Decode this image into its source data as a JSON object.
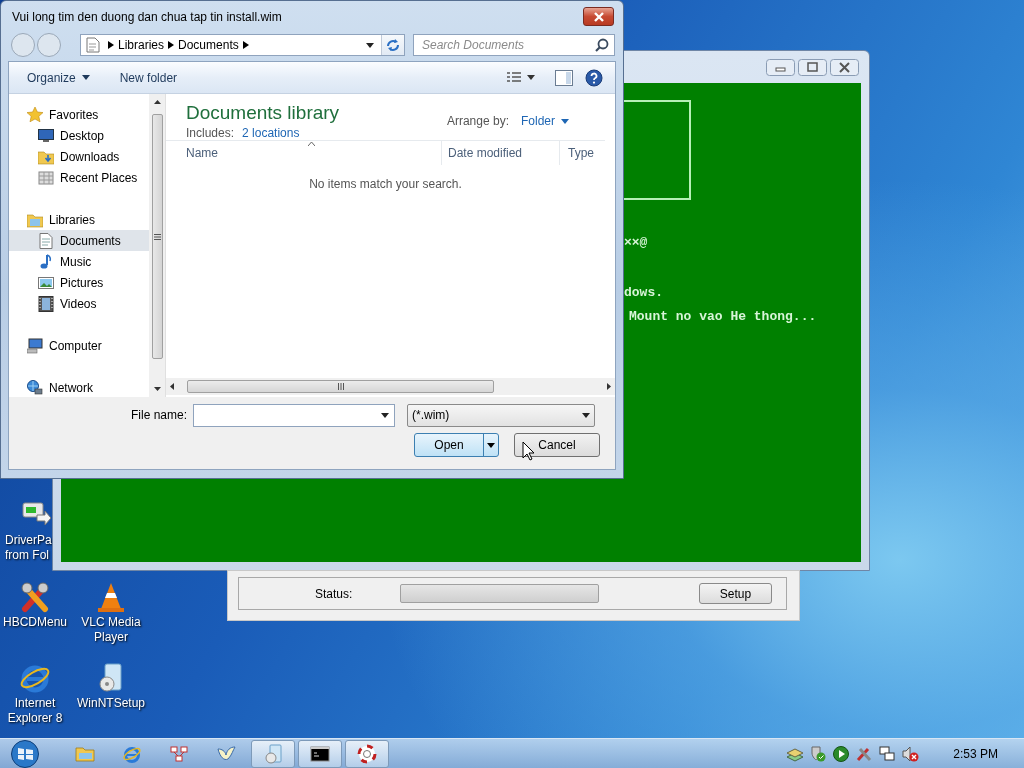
{
  "desktop_icons": [
    {
      "lines": [
        "DriverPa",
        "from Fol"
      ]
    },
    {
      "lines": [
        "HBCDMenu"
      ]
    },
    {
      "lines": [
        "VLC Media",
        "Player"
      ]
    },
    {
      "lines": [
        "Internet",
        "Explorer 8"
      ]
    },
    {
      "lines": [
        "WinNTSetup"
      ]
    }
  ],
  "console_window": {
    "lines": [
      "××@",
      "dows.",
      "Mount no vao He thong..."
    ]
  },
  "setup_window": {
    "status_label": "Status:",
    "progress": {
      "level": 0
    },
    "setup_button": "Setup"
  },
  "dialog": {
    "title": "Vui long tim den duong dan chua tap tin install.wim",
    "breadcrumb": [
      "Libraries",
      "Documents"
    ],
    "search": {
      "placeholder": "Search Documents"
    },
    "toolbar": {
      "organize": "Organize",
      "new_folder": "New folder"
    },
    "navigation": [
      {
        "label": "Favorites",
        "selected": false,
        "children": [
          {
            "label": "Desktop",
            "selected": false
          },
          {
            "label": "Downloads",
            "selected": false
          },
          {
            "label": "Recent Places",
            "selected": false
          }
        ]
      },
      {
        "label": "Libraries",
        "selected": false,
        "children": [
          {
            "label": "Documents",
            "selected": true
          },
          {
            "label": "Music",
            "selected": false
          },
          {
            "label": "Pictures",
            "selected": false
          },
          {
            "label": "Videos",
            "selected": false
          }
        ]
      },
      {
        "label": "Computer",
        "selected": false
      },
      {
        "label": "Network",
        "selected": false
      }
    ],
    "library_title": "Documents library",
    "includes_label": "Includes:",
    "includes_link": "2 locations",
    "arrange_label": "Arrange by:",
    "arrange_value": "Folder",
    "columns": [
      {
        "label": "Name",
        "sorted": true
      },
      {
        "label": "Date modified",
        "sorted": false
      },
      {
        "label": "Type",
        "sorted": false
      }
    ],
    "empty_message": "No items match your search.",
    "file_name_label": "File name:",
    "file_type": "(*.wim)",
    "open_button": "Open",
    "cancel_button": "Cancel"
  },
  "taskbar": {
    "items": [
      {
        "kind": "pinned"
      },
      {
        "kind": "pinned"
      },
      {
        "kind": "pinned"
      },
      {
        "kind": "pinned"
      },
      {
        "kind": "running"
      },
      {
        "kind": "running"
      },
      {
        "kind": "running"
      }
    ],
    "clock": "2:53 PM"
  }
}
